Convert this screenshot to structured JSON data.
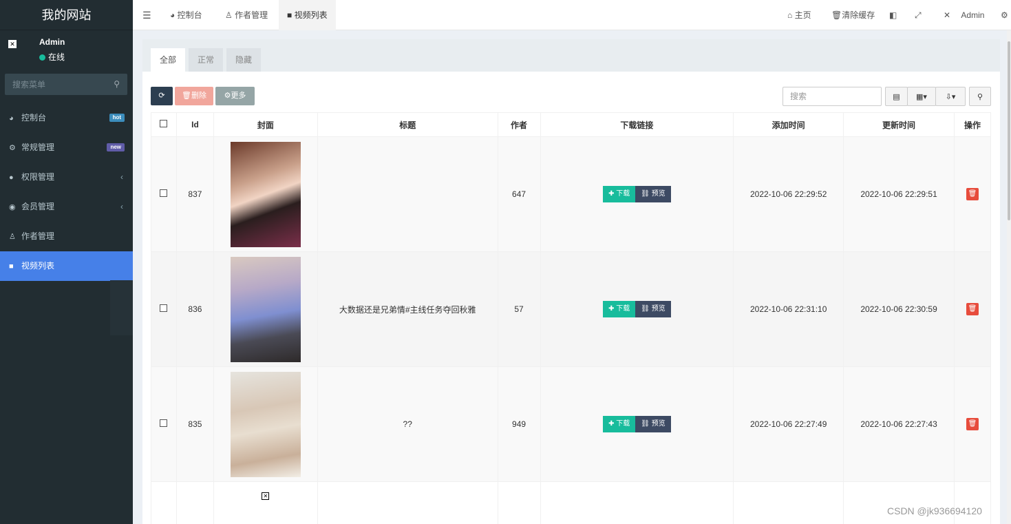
{
  "sidebar": {
    "logo": "我的网站",
    "user_name": "Admin",
    "user_status": "在线",
    "search_placeholder": "搜索菜单",
    "items": [
      {
        "label": "控制台",
        "icon": "dashboard-icon",
        "badge": "hot"
      },
      {
        "label": "常规管理",
        "icon": "cogs-icon",
        "badge": "new"
      },
      {
        "label": "权限管理",
        "icon": "users-icon",
        "chevron": "‹"
      },
      {
        "label": "会员管理",
        "icon": "user-circle-icon",
        "chevron": "‹"
      },
      {
        "label": "作者管理",
        "icon": "user-icon"
      },
      {
        "label": "视频列表",
        "icon": "video-icon",
        "active": true
      }
    ]
  },
  "topbar": {
    "tabs": [
      "控制台",
      "作者管理",
      "视频列表"
    ],
    "home": "主页",
    "clear_cache": "清除缓存",
    "admin": "Admin"
  },
  "panel": {
    "tabs": [
      "全部",
      "正常",
      "隐藏"
    ],
    "delete_label": "删除",
    "more_label": "更多",
    "search_placeholder": "搜索"
  },
  "table": {
    "headers": [
      "Id",
      "封面",
      "标题",
      "作者",
      "下载链接",
      "添加时间",
      "更新时间",
      "操作"
    ],
    "download_label": "下载",
    "preview_label": "预览",
    "rows": [
      {
        "id": "837",
        "title": "",
        "author": "647",
        "added": "2022-10-06 22:29:52",
        "updated": "2022-10-06 22:29:51"
      },
      {
        "id": "836",
        "title": "大数据还是兄弟情#主线任务夺回秋雅",
        "author": "57",
        "added": "2022-10-06 22:31:10",
        "updated": "2022-10-06 22:30:59"
      },
      {
        "id": "835",
        "title": "??",
        "author": "949",
        "added": "2022-10-06 22:27:49",
        "updated": "2022-10-06 22:27:43"
      }
    ]
  },
  "watermark": "CSDN @jk936694120",
  "colors": {
    "sidebar": "#222d32",
    "active": "#4680e8",
    "green": "#18bc9c",
    "danger": "#e74c3c"
  }
}
